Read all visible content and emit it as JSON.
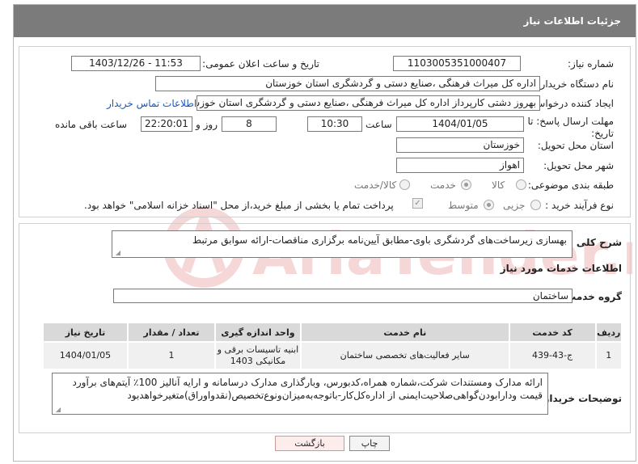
{
  "header": {
    "title": "جزئیات اطلاعات نیاز"
  },
  "fields": {
    "need_number_label": "شماره نیاز:",
    "need_number": "1103005351000407",
    "announce_label": "تاریخ و ساعت اعلان عمومی:",
    "announce_value": "1403/12/26 - 11:53",
    "buyer_org_label": "نام دستگاه خریدار:",
    "buyer_org": "اداره کل میراث فرهنگی ،صنایع دستی و گردشگری استان خوزستان",
    "creator_label": "ایجاد کننده درخواست:",
    "creator": "بهروز دشتی کارپرداز اداره کل میراث فرهنگی ،صنایع دستی و گردشگری استان خوزستان",
    "contact_link": "اطلاعات تماس خریدار",
    "deadline_label": "مهلت ارسال پاسخ: تا تاریخ:",
    "deadline_date": "1404/01/05",
    "time_label": "ساعت",
    "deadline_time": "10:30",
    "days_value": "8",
    "days_label": "روز و",
    "remaining_time": "22:20:01",
    "remaining_label": "ساعت باقی مانده",
    "province_label": "استان محل تحویل:",
    "province": "خوزستان",
    "city_label": "شهر محل تحویل:",
    "city": "اهواز",
    "category_label": "طبقه بندی موضوعی:",
    "category_options": [
      "کالا",
      "خدمت",
      "کالا/خدمت"
    ],
    "category_selected": "خدمت",
    "process_label": "نوع فرآیند خرید :",
    "process_options": [
      "جزیی",
      "متوسط"
    ],
    "process_selected": "متوسط",
    "payment_note": "پرداخت تمام یا بخشی از مبلغ خرید،از محل \"اسناد خزانه اسلامی\" خواهد بود."
  },
  "description": {
    "label": "شرح کلی نیاز:",
    "text": "بهسازی زیرساخت‌های گردشگری باوی-مطابق آیین‌نامه برگزاری مناقصات-ارائه سوابق مرتبط"
  },
  "services": {
    "section_title": "اطلاعات خدمات مورد نیاز",
    "group_label": "گروه خدمت:",
    "group_value": "ساختمان",
    "columns": [
      "ردیف",
      "کد خدمت",
      "نام خدمت",
      "واحد اندازه گیری",
      "تعداد / مقدار",
      "تاریخ نیاز"
    ],
    "rows": [
      [
        "1",
        "ج-43-439",
        "سایر فعالیت‌های تخصصی ساختمان",
        "ابنیه تاسیسات برقی و مکانیکی 1403",
        "1",
        "1404/01/05"
      ]
    ]
  },
  "buyer_notes": {
    "label": "توضیحات خریدار:",
    "text": "ارائه مدارک ومستندات شرکت،شماره همراه،کدبورس، وبارگذاری مدارک درسامانه و ارایه آنالیز 100٪ آیتم‌های برآورد قیمت ودارابودن‌گواهی‌صلاحیت‌ایمنی از اداره‌کل‌کار-باتوجه‌به‌میزان‌ونوع‌تخصیص(نقدواوراق)متغیرخواهدبود"
  },
  "buttons": {
    "print": "چاپ",
    "back": "بازگشت"
  },
  "watermark": {
    "text": "AriaTender.neT"
  },
  "colors": {
    "header_bg": "#7b7b7b",
    "link": "#1b57b8",
    "watermark": "#e9a8a8"
  }
}
